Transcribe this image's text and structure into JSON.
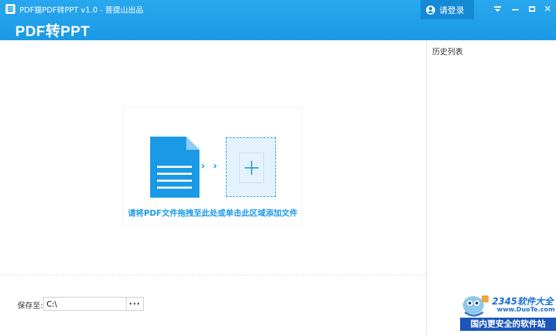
{
  "window": {
    "title": "PDF猫PDF转PPT v1.0 - 菩提山出品",
    "heading": "PDF转PPT",
    "login_label": "请登录"
  },
  "colors": {
    "accent": "#1a9ae6",
    "titlebar": "#29a8ee",
    "drop_bg": "#e4f2fb"
  },
  "icons": [
    "app-icon",
    "user-icon",
    "menu-icon",
    "minimize-icon",
    "maximize-icon",
    "close-icon",
    "pdf-file-icon",
    "arrow-icon",
    "plus-icon"
  ],
  "main": {
    "arrows": "› › ›",
    "drop_hint": "请将PDF文件拖拽至此处或单击此区域添加文件",
    "save_label": "保存至:",
    "save_path": "C:\\",
    "browse_label": "···"
  },
  "history": {
    "title": "历史列表"
  },
  "watermark": {
    "brand": "2345软件大全",
    "url": "www.DuoTe.com",
    "tagline": "国内更安全的软件站"
  }
}
